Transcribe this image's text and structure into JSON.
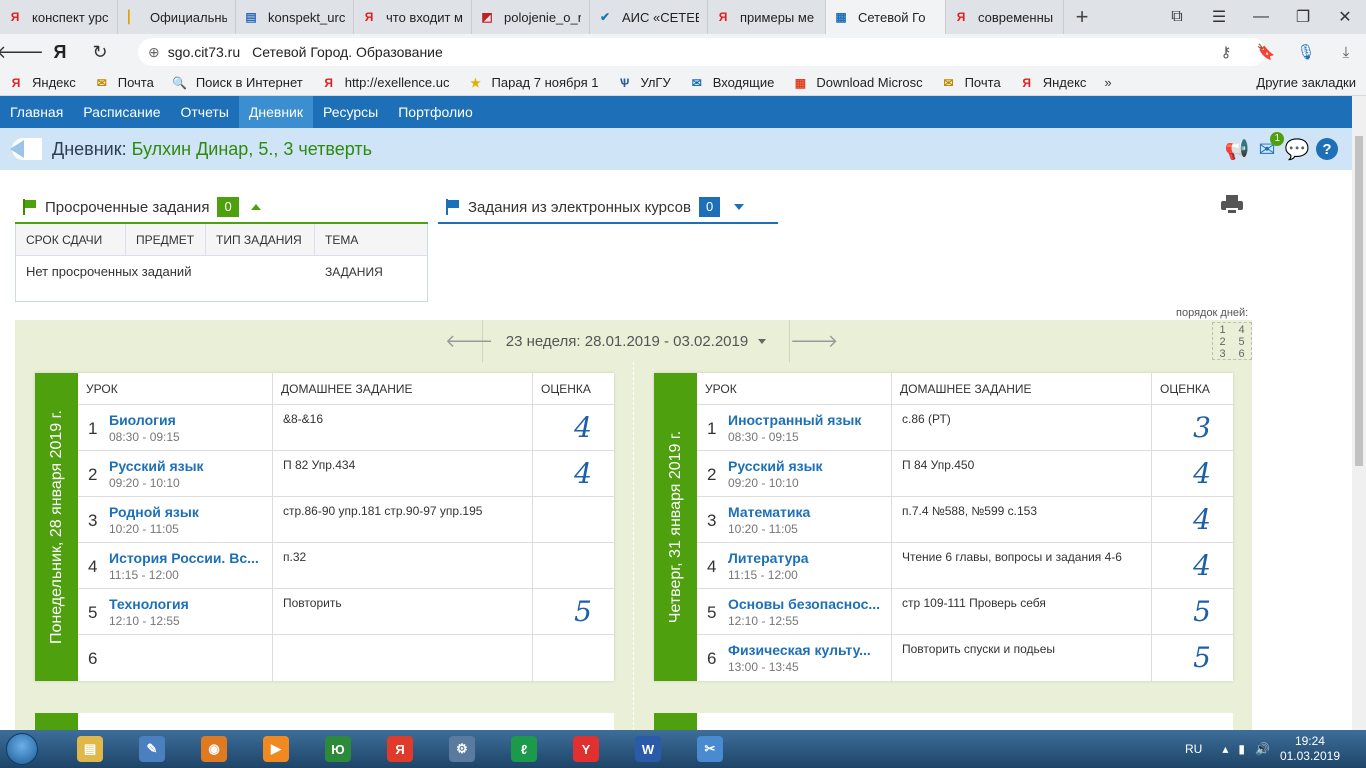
{
  "browser": {
    "tabs": [
      {
        "icon": "yandex-icon",
        "title": "конспект урс",
        "active": false
      },
      {
        "icon": "document-icon",
        "title": "Официальны",
        "active": false
      },
      {
        "icon": "doc-file-icon",
        "title": "konspekt_urc",
        "active": false
      },
      {
        "icon": "yandex-icon",
        "title": "что входит м",
        "active": false
      },
      {
        "icon": "pdf-icon",
        "title": "polojenie_o_r",
        "active": false
      },
      {
        "icon": "check-icon",
        "title": "АИС «СЕТЕВС",
        "active": false
      },
      {
        "icon": "yandex-icon",
        "title": "примеры ме",
        "active": false
      },
      {
        "icon": "site-icon",
        "title": "Сетевой Го",
        "active": true
      },
      {
        "icon": "yandex-icon",
        "title": "современны",
        "active": false
      }
    ],
    "new_tab": "+",
    "address": {
      "domain": "sgo.cit73.ru",
      "page_title": "Сетевой Город. Образование"
    },
    "bookmarks": [
      {
        "icon": "yandex-icon",
        "label": "Яндекс"
      },
      {
        "icon": "mail-icon",
        "label": "Почта"
      },
      {
        "icon": "search-icon",
        "label": "Поиск в Интернет"
      },
      {
        "icon": "yandex-icon",
        "label": "http://exellence.uc"
      },
      {
        "icon": "star-icon",
        "label": "Парад 7 ноября 1"
      },
      {
        "icon": "ulgu-icon",
        "label": "УлГУ"
      },
      {
        "icon": "inbox-icon",
        "label": "Входящие"
      },
      {
        "icon": "windows-icon",
        "label": "Download Microsc"
      },
      {
        "icon": "mail-icon",
        "label": "Почта"
      },
      {
        "icon": "yandex-icon",
        "label": "Яндекс"
      }
    ],
    "bookmarks_more": "»",
    "other_bookmarks": "Другие закладки"
  },
  "site": {
    "nav": [
      {
        "label": "Главная",
        "active": false
      },
      {
        "label": "Расписание",
        "active": false
      },
      {
        "label": "Отчеты",
        "active": false
      },
      {
        "label": "Дневник",
        "active": true
      },
      {
        "label": "Ресурсы",
        "active": false
      },
      {
        "label": "Портфолио",
        "active": false
      }
    ],
    "title_prefix": "Дневник:",
    "title_who": "Булхин Динар, 5., 3 четверть",
    "mail_badge": "1"
  },
  "overdue": {
    "title": "Просроченные задания",
    "count": "0",
    "columns": [
      "СРОК СДАЧИ",
      "ПРЕДМЕТ",
      "ТИП ЗАДАНИЯ",
      "ТЕМА ЗАДАНИЯ"
    ],
    "empty_text": "Нет просроченных заданий"
  },
  "courses": {
    "title": "Задания из электронных курсов",
    "count": "0"
  },
  "days_order_label": "порядок дней:",
  "days_order": [
    "1",
    "4",
    "2",
    "5",
    "3",
    "6"
  ],
  "week": {
    "prev": "🡐",
    "label": "23 неделя: 28.01.2019 - 03.02.2019",
    "next": "🡒"
  },
  "table_columns": {
    "lesson": "УРОК",
    "homework": "ДОМАШНЕЕ ЗАДАНИЕ",
    "mark": "ОЦЕНКА"
  },
  "days": [
    {
      "label": "Понедельник, 28 января 2019 г.",
      "lessons": [
        {
          "num": "1",
          "name": "Биология",
          "time": "08:30 - 09:15",
          "homework": "&8-&16",
          "mark": "4"
        },
        {
          "num": "2",
          "name": "Русский язык",
          "time": "09:20 - 10:10",
          "homework": "П 82 Упр.434",
          "mark": "4"
        },
        {
          "num": "3",
          "name": "Родной язык",
          "time": "10:20 - 11:05",
          "homework": "стр.86-90 упр.181 стр.90-97 упр.195",
          "mark": ""
        },
        {
          "num": "4",
          "name": "История России. Вс...",
          "time": "11:15 - 12:00",
          "homework": "п.32",
          "mark": ""
        },
        {
          "num": "5",
          "name": "Технология",
          "time": "12:10 - 12:55",
          "homework": "Повторить",
          "mark": "5"
        },
        {
          "num": "6",
          "name": "",
          "time": "",
          "homework": "",
          "mark": ""
        }
      ]
    },
    {
      "label": "Четверг, 31 января 2019 г.",
      "lessons": [
        {
          "num": "1",
          "name": "Иностранный язык",
          "time": "08:30 - 09:15",
          "homework": "с.86 (РТ)",
          "mark": "3"
        },
        {
          "num": "2",
          "name": "Русский язык",
          "time": "09:20 - 10:10",
          "homework": "П 84 Упр.450",
          "mark": "4"
        },
        {
          "num": "3",
          "name": "Математика",
          "time": "10:20 - 11:05",
          "homework": "п.7.4 №588, №599 с.153",
          "mark": "4"
        },
        {
          "num": "4",
          "name": "Литература",
          "time": "11:15 - 12:00",
          "homework": "Чтение 6 главы, вопросы и задания 4-6",
          "mark": "4"
        },
        {
          "num": "5",
          "name": "Основы безопаснос...",
          "time": "12:10 - 12:55",
          "homework": "стр 109-111 Проверь себя",
          "mark": "5"
        },
        {
          "num": "6",
          "name": "Физическая культу...",
          "time": "13:00 - 13:45",
          "homework": "Повторить спуски и подьеы",
          "mark": "5"
        }
      ]
    }
  ],
  "taskbar": {
    "apps": [
      {
        "icon": "explorer-icon",
        "color": "#e0b84a"
      },
      {
        "icon": "paint-icon",
        "color": "#4a7fc0"
      },
      {
        "icon": "firefox-icon",
        "color": "#e07a20"
      },
      {
        "icon": "media-player-icon",
        "color": "#f08a20"
      },
      {
        "icon": "yu-icon",
        "color": "#2c8a3a"
      },
      {
        "icon": "yandex-browser-icon",
        "color": "#e03a2a"
      },
      {
        "icon": "control-panel-icon",
        "color": "#5a7aa0"
      },
      {
        "icon": "green-app-icon",
        "color": "#1a9a4a"
      },
      {
        "icon": "yandex-y-icon",
        "color": "#e03030"
      },
      {
        "icon": "word-icon",
        "color": "#2a5aa8"
      },
      {
        "icon": "snipping-icon",
        "color": "#4a8ad0"
      }
    ],
    "lang": "RU",
    "time": "19:24",
    "date": "01.03.2019"
  }
}
